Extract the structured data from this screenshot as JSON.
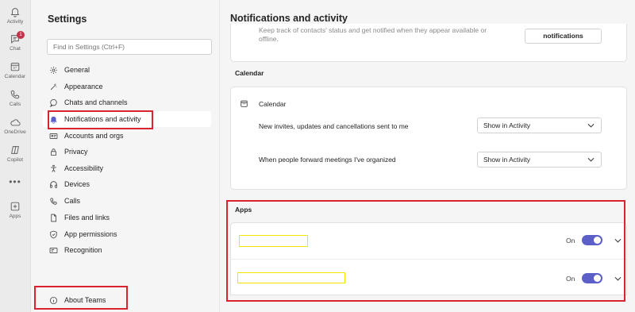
{
  "rail": {
    "activity": "Activity",
    "chat": "Chat",
    "chat_badge": "1",
    "calendar": "Calendar",
    "calls": "Calls",
    "onedrive": "OneDrive",
    "copilot": "Copilot",
    "more": "•••",
    "apps": "Apps"
  },
  "nav": {
    "title": "Settings",
    "search_placeholder": "Find in Settings (Ctrl+F)",
    "items": [
      {
        "label": "General",
        "icon": "gear-icon"
      },
      {
        "label": "Appearance",
        "icon": "wand-icon"
      },
      {
        "label": "Chats and channels",
        "icon": "chat-bubble-icon"
      },
      {
        "label": "Notifications and activity",
        "icon": "bell-icon",
        "active": true
      },
      {
        "label": "Accounts and orgs",
        "icon": "id-card-icon"
      },
      {
        "label": "Privacy",
        "icon": "lock-icon"
      },
      {
        "label": "Accessibility",
        "icon": "accessibility-icon"
      },
      {
        "label": "Devices",
        "icon": "headset-icon"
      },
      {
        "label": "Calls",
        "icon": "phone-icon"
      },
      {
        "label": "Files and links",
        "icon": "file-icon"
      },
      {
        "label": "App permissions",
        "icon": "shield-icon"
      },
      {
        "label": "Recognition",
        "icon": "recognition-icon"
      }
    ],
    "about": "About Teams"
  },
  "main": {
    "title": "Notifications and activity",
    "clipped_text": "Keep track of contacts' status and get notified when they appear available or offline.",
    "notifications_button": "notifications",
    "calendar": {
      "section_title": "Calendar",
      "card_title": "Calendar",
      "rows": [
        {
          "label": "New invites, updates and cancellations sent to me",
          "value": "Show in Activity"
        },
        {
          "label": "When people forward meetings I've organized",
          "value": "Show in Activity"
        }
      ]
    },
    "apps": {
      "section_title": "Apps",
      "rows": [
        {
          "status": "On",
          "enabled": true
        },
        {
          "status": "On",
          "enabled": true
        }
      ]
    }
  },
  "colors": {
    "accent": "#5b5fc7",
    "highlight_red": "#d9232e",
    "highlight_yellow": "#f2e600",
    "badge": "#c4314b"
  }
}
